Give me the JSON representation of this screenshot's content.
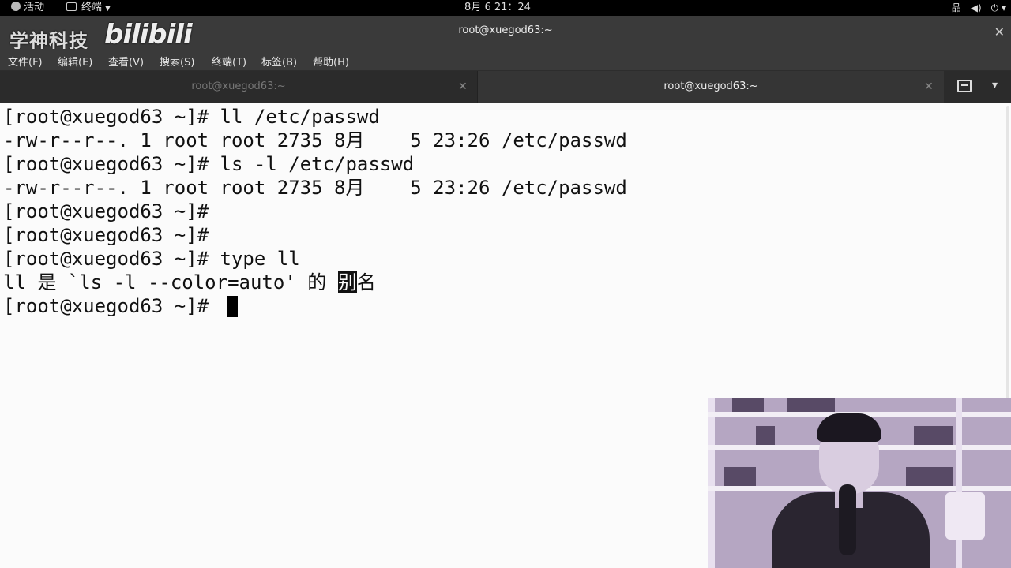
{
  "topbar": {
    "activities": "活动",
    "app_name": "终端",
    "clock": "8月 6  21：24",
    "status_icons": [
      "network-icon",
      "volume-icon",
      "power-icon"
    ]
  },
  "window": {
    "title": "root@xuegod63:~",
    "watermark_cn": "学神科技",
    "watermark_bili": "bilibili"
  },
  "menu": [
    "文件(F)",
    "编辑(E)",
    "查看(V)",
    "搜索(S)",
    "终端(T)",
    "标签(B)",
    "帮助(H)"
  ],
  "tabs": [
    {
      "label": "root@xuegod63:~",
      "active": false
    },
    {
      "label": "root@xuegod63:~",
      "active": true
    }
  ],
  "terminal": {
    "lines": [
      "[root@xuegod63 ~]# ll /etc/passwd",
      "-rw-r--r--. 1 root root 2735 8月    5 23:26 /etc/passwd",
      "[root@xuegod63 ~]# ls -l /etc/passwd",
      "-rw-r--r--. 1 root root 2735 8月    5 23:26 /etc/passwd",
      "[root@xuegod63 ~]#",
      "[root@xuegod63 ~]#",
      "[root@xuegod63 ~]# type ll"
    ],
    "alias_line": {
      "before": "ll 是 `ls -l --color=auto' 的 ",
      "highlight": "别",
      "after": "名"
    },
    "prompt": "[root@xuegod63 ~]# "
  },
  "colors": {
    "terminal_bg": "#fbfbfb",
    "terminal_fg": "#111111",
    "chrome_bg": "#3a3a3a",
    "topbar_bg": "#000000"
  }
}
